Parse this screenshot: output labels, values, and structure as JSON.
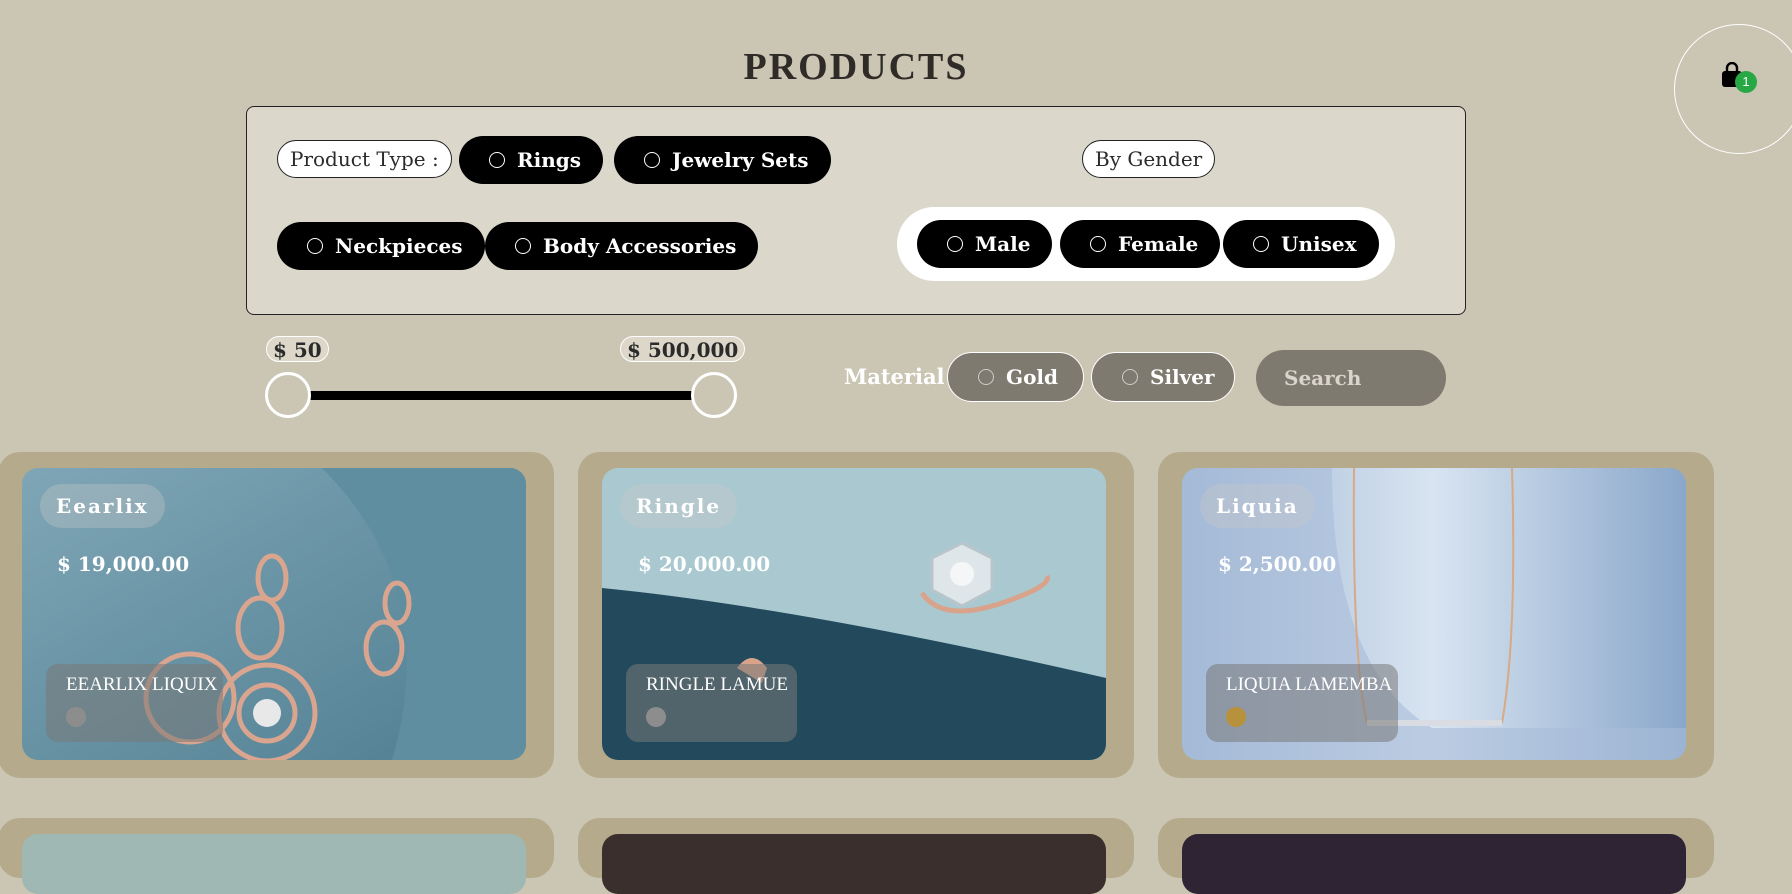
{
  "page": {
    "title": "PRODUCTS"
  },
  "cart": {
    "count": "1"
  },
  "filters": {
    "product_type_label": "Product Type :",
    "product_types": [
      "Rings",
      "Jewelry Sets",
      "Neckpieces",
      "Body Accessories"
    ],
    "gender_label": "By Gender",
    "genders": [
      "Male",
      "Female",
      "Unisex"
    ]
  },
  "price_range": {
    "min_label": "$ 50",
    "max_label": "$ 500,000"
  },
  "material": {
    "label": "Material :",
    "options": [
      "Gold",
      "Silver"
    ]
  },
  "search": {
    "placeholder": "Search"
  },
  "products": [
    {
      "brand": "Eearlix",
      "price": "$ 19,000.00",
      "name": "EEARLIX LIQUIX",
      "swatch_color": "#8d8d8d"
    },
    {
      "brand": "Ringle",
      "price": "$ 20,000.00",
      "name": "RINGLE LAMUE",
      "swatch_color": "#8d8d8d"
    },
    {
      "brand": "Liquia",
      "price": "$ 2,500.00",
      "name": "LIQUIA LAMEMBA",
      "swatch_color": "#b8923a"
    }
  ],
  "colors": {
    "background": "#cbc5b4",
    "card": "#b5ab8c",
    "pill": "#000000",
    "material_pill": "#7f7a6f",
    "badge": "#28a745"
  }
}
